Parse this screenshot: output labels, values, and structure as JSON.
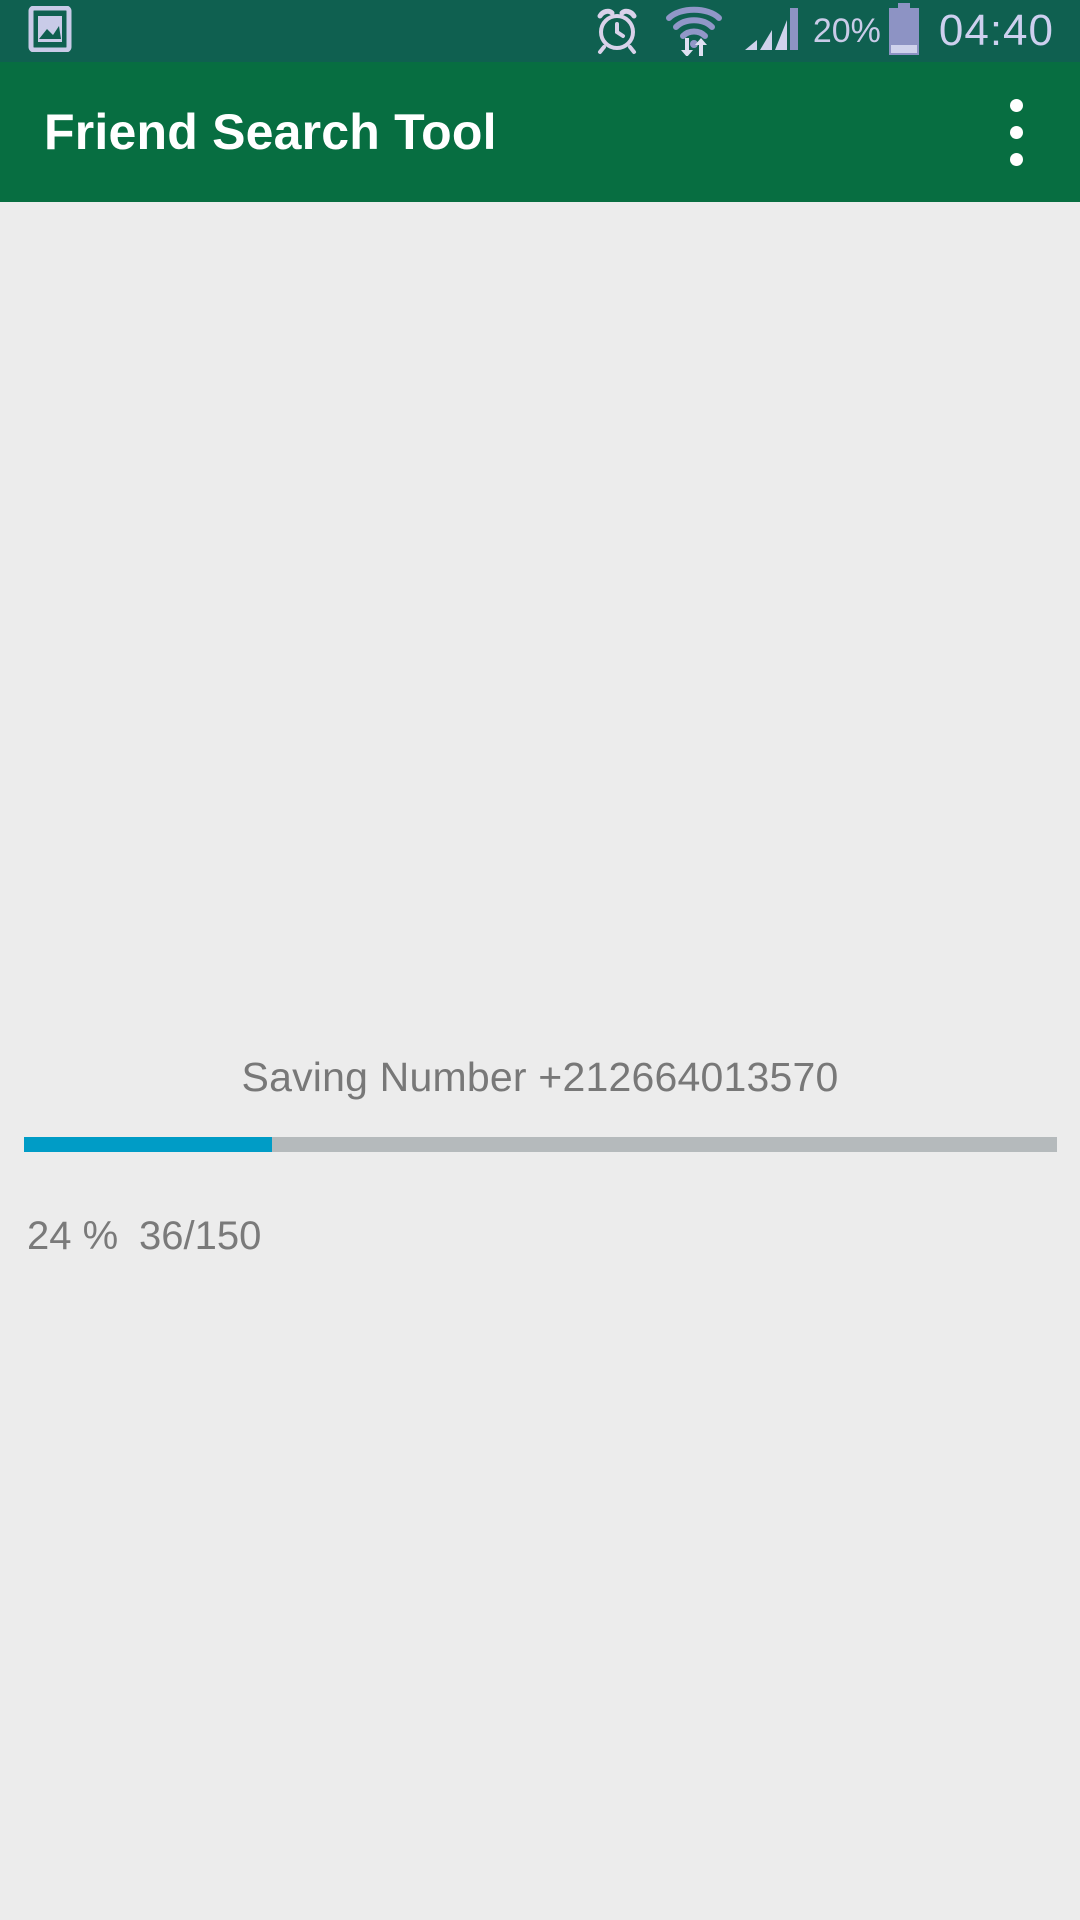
{
  "status_bar": {
    "background_color": "#0f6050",
    "icon_color": "#c9cbe8",
    "left_icons": [
      {
        "name": "photo-gallery-icon",
        "label": "Gallery"
      }
    ],
    "right_icons": [
      {
        "name": "alarm-clock-icon",
        "label": "Alarm"
      },
      {
        "name": "wifi-data-transfer-icon",
        "label": "Wi-Fi"
      },
      {
        "name": "cellular-signal-icon",
        "label": "Signal"
      }
    ],
    "battery_percent": "20%",
    "battery_icon": "battery-icon",
    "clock": "04:40"
  },
  "toolbar": {
    "title": "Friend Search Tool",
    "background_color": "#076e41",
    "title_color": "#ffffff",
    "overflow_menu": {
      "name": "overflow-menu-button",
      "label": "More options",
      "dot_count": 3
    }
  },
  "main": {
    "background_color": "#ececec",
    "saving_status": "Saving Number +212664013570",
    "progress": {
      "percent_value": 24,
      "percent_label": "24 %",
      "count_label": "36/150",
      "current": 36,
      "total": 150,
      "fill_color": "#009cc6",
      "track_color": "#b5babc"
    }
  }
}
